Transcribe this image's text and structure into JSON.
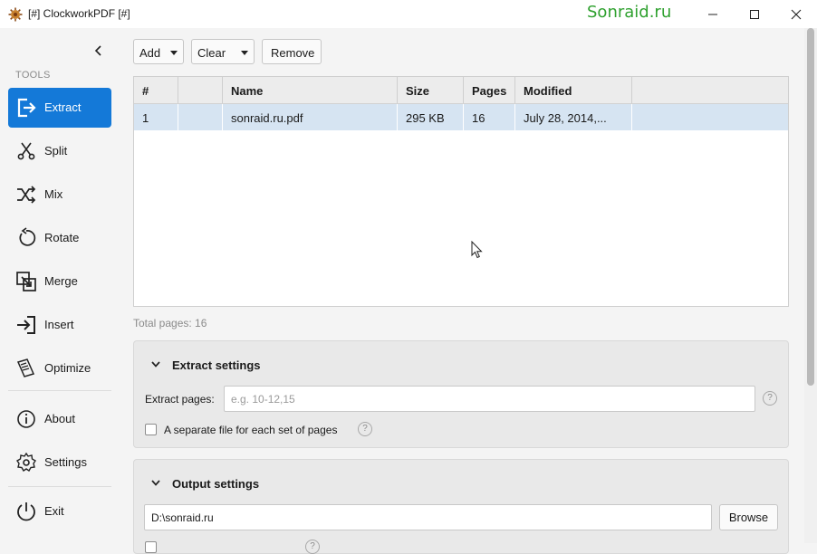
{
  "titlebar": {
    "title": "[#] ClockworkPDF [#]",
    "watermark": "Sonraid.ru",
    "buttons": [
      "minimize-icon",
      "maximize-icon",
      "close-icon"
    ]
  },
  "sidebar": {
    "section_label": "TOOLS",
    "items": [
      {
        "label": "Extract",
        "icon": "extract-icon",
        "active": true
      },
      {
        "label": "Split",
        "icon": "scissors-icon"
      },
      {
        "label": "Mix",
        "icon": "shuffle-icon"
      },
      {
        "label": "Rotate",
        "icon": "rotate-icon"
      },
      {
        "label": "Merge",
        "icon": "merge-icon"
      },
      {
        "label": "Insert",
        "icon": "insert-icon"
      },
      {
        "label": "Optimize",
        "icon": "optimize-icon"
      }
    ],
    "bottom_items": [
      {
        "label": "About",
        "icon": "info-icon"
      },
      {
        "label": "Settings",
        "icon": "gear-icon"
      },
      {
        "label": "Exit",
        "icon": "power-icon"
      }
    ],
    "accent_color": "#1479d8"
  },
  "toolbar": {
    "add_label": "Add",
    "clear_label": "Clear",
    "remove_label": "Remove"
  },
  "table": {
    "columns": [
      "#",
      "",
      "Name",
      "Size",
      "Pages",
      "Modified"
    ],
    "rows": [
      {
        "num": "1",
        "flag": "",
        "name": "sonraid.ru.pdf",
        "size": "295 KB",
        "pages": "16",
        "modified": "July 28, 2014,..."
      }
    ],
    "selected_row_color": "#d6e4f2"
  },
  "summary": {
    "total_pages": "Total pages: 16"
  },
  "extract_settings": {
    "title": "Extract settings",
    "pages_label": "Extract pages:",
    "pages_placeholder": "e.g. 10-12,15",
    "pages_value": "",
    "separate_file_label": "A separate file for each set of pages",
    "separate_file_checked": false
  },
  "output_settings": {
    "title": "Output settings",
    "path_value": "D:\\sonraid.ru",
    "browse_label": "Browse"
  }
}
